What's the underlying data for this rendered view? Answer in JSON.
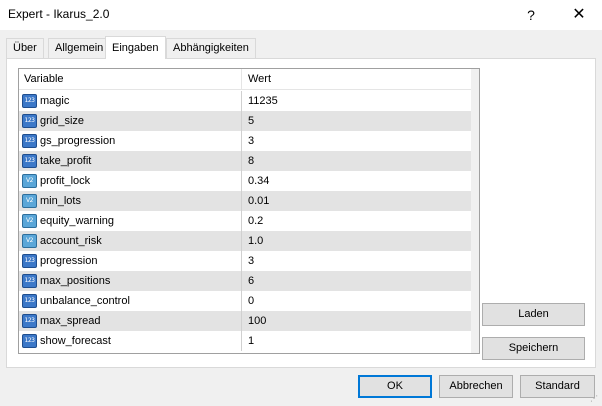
{
  "window": {
    "title": "Expert - Ikarus_2.0",
    "help_icon": "?",
    "close_icon": "✕"
  },
  "tabs": [
    {
      "label": "Über"
    },
    {
      "label": "Allgemein"
    },
    {
      "label": "Eingaben",
      "active": true
    },
    {
      "label": "Abhängigkeiten"
    }
  ],
  "grid": {
    "col_variable": "Variable",
    "col_value": "Wert",
    "rows": [
      {
        "type": "int",
        "icon_text": "123",
        "name": "magic",
        "value": "11235"
      },
      {
        "type": "int",
        "icon_text": "123",
        "name": "grid_size",
        "value": "5"
      },
      {
        "type": "int",
        "icon_text": "123",
        "name": "gs_progression",
        "value": "3"
      },
      {
        "type": "int",
        "icon_text": "123",
        "name": "take_profit",
        "value": "8"
      },
      {
        "type": "double",
        "icon_text": "V2",
        "name": "profit_lock",
        "value": "0.34"
      },
      {
        "type": "double",
        "icon_text": "V2",
        "name": "min_lots",
        "value": "0.01"
      },
      {
        "type": "double",
        "icon_text": "V2",
        "name": "equity_warning",
        "value": "0.2"
      },
      {
        "type": "double",
        "icon_text": "V2",
        "name": "account_risk",
        "value": "1.0"
      },
      {
        "type": "int",
        "icon_text": "123",
        "name": "progression",
        "value": "3"
      },
      {
        "type": "int",
        "icon_text": "123",
        "name": "max_positions",
        "value": "6"
      },
      {
        "type": "int",
        "icon_text": "123",
        "name": "unbalance_control",
        "value": "0"
      },
      {
        "type": "int",
        "icon_text": "123",
        "name": "max_spread",
        "value": "100"
      },
      {
        "type": "int",
        "icon_text": "123",
        "name": "show_forecast",
        "value": "1"
      }
    ]
  },
  "buttons": {
    "load": "Laden",
    "save": "Speichern",
    "ok": "OK",
    "cancel": "Abbrechen",
    "standard": "Standard"
  },
  "colors": {
    "alt_row": "#e3e3e3",
    "int_icon": "#3c78c8",
    "double_icon": "#5aa6d8",
    "ok_border": "#0078d7"
  }
}
